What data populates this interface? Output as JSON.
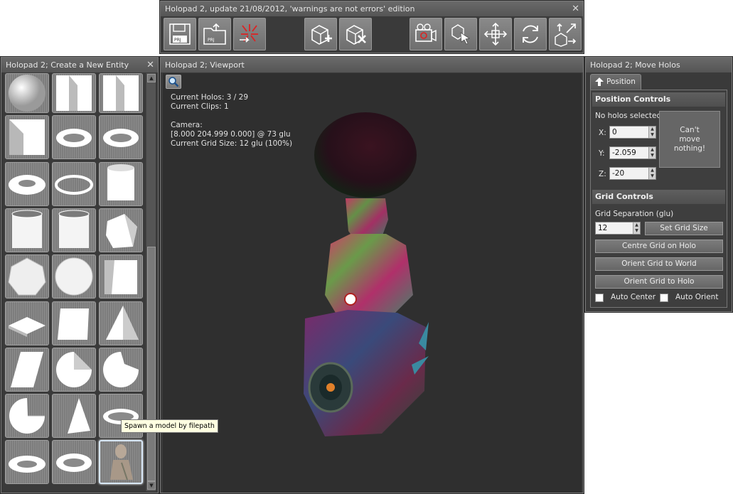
{
  "toolbar_window": {
    "title": "Holopad 2, update 21/08/2012, 'warnings are not errors' edition",
    "buttons": [
      "save-project",
      "open-project",
      "new-project",
      "add-holo",
      "delete-holo",
      "clip-camera",
      "select-tool",
      "move-tool",
      "rotate-tool",
      "scale-tool"
    ]
  },
  "entity_window": {
    "title": "Holopad 2; Create a New Entity",
    "tooltip": "Spawn a model by filepath",
    "icons": [
      "sphere",
      "cube-notch",
      "cube-notch",
      "cube-wedge",
      "torus",
      "torus",
      "torus-thick",
      "ring",
      "cylinder",
      "tube",
      "tube",
      "hexagon-cube",
      "icosphere",
      "dodecasphere",
      "wedge-cube",
      "prism",
      "cube",
      "pyramid",
      "wedge",
      "half-sphere",
      "quarter-sphere",
      "quarter-sphere-large",
      "cone",
      "torus-thin",
      "torus-small",
      "torus",
      "bust-model"
    ]
  },
  "viewport_window": {
    "title": "Holopad 2; Viewport",
    "current_holos": "Current Holos: 3 / 29",
    "current_clips": "Current Clips: 1",
    "camera_label": "Camera:",
    "camera_value": "[8.000 204.999 0.000] @ 73 glu",
    "grid_size": "Current Grid Size: 12 glu (100%)"
  },
  "move_window": {
    "title": "Holopad 2; Move Holos",
    "tab_label": "Position",
    "position_controls": "Position Controls",
    "status": "No holos selected!",
    "x_label": "X:",
    "x_value": "0",
    "y_label": "Y:",
    "y_value": "-2.059",
    "z_label": "Z:",
    "z_value": "-20",
    "cant_move": "Can't move nothing!",
    "grid_controls": "Grid Controls",
    "grid_sep_label": "Grid Separation (glu)",
    "grid_sep_value": "12",
    "set_grid_size": "Set Grid Size",
    "centre_grid": "Centre Grid on Holo",
    "orient_world": "Orient Grid to World",
    "orient_holo": "Orient Grid to Holo",
    "auto_center": "Auto Center",
    "auto_orient": "Auto Orient"
  }
}
